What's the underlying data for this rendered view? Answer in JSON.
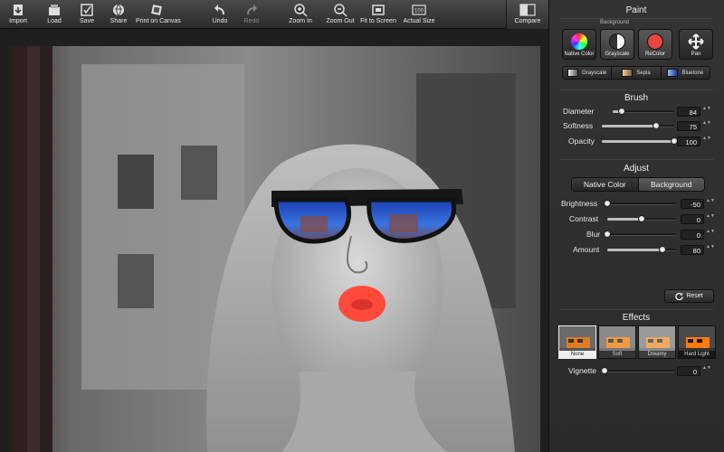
{
  "toolbar": {
    "items": [
      {
        "label": "Import",
        "icon": "import-icon"
      },
      {
        "label": "Load",
        "icon": "load-icon"
      },
      {
        "label": "Save",
        "icon": "save-icon"
      },
      {
        "label": "Share",
        "icon": "share-icon"
      },
      {
        "label": "Print on Canvas",
        "icon": "print-canvas-icon"
      },
      {
        "label": "Undo",
        "icon": "undo-icon"
      },
      {
        "label": "Redo",
        "icon": "redo-icon"
      },
      {
        "label": "Zoom In",
        "icon": "zoom-in-icon"
      },
      {
        "label": "Zoom Out",
        "icon": "zoom-out-icon"
      },
      {
        "label": "Fit to Screen",
        "icon": "fit-screen-icon"
      },
      {
        "label": "Actual Size",
        "icon": "actual-size-icon"
      }
    ],
    "compare": "Compare"
  },
  "panel": {
    "paint": {
      "title": "Paint",
      "background_label": "Background",
      "buttons": [
        {
          "label": "Native Color",
          "icon": "color-wheel-icon"
        },
        {
          "label": "Grayscale",
          "icon": "grayscale-icon"
        },
        {
          "label": "ReColor",
          "icon": "recolor-icon"
        },
        {
          "label": "Pan",
          "icon": "pan-icon"
        }
      ],
      "modes": [
        "Grayscale",
        "Sepia",
        "Bluetone"
      ]
    },
    "brush": {
      "title": "Brush",
      "diameter": {
        "label": "Diameter",
        "value": "84",
        "level": 0.14
      },
      "softness": {
        "label": "Softness",
        "value": "75",
        "level": 0.75
      },
      "opacity": {
        "label": "Opacity",
        "value": "100",
        "level": 1.0
      }
    },
    "adjust": {
      "title": "Adjust",
      "tabs": [
        "Native Color",
        "Background"
      ],
      "brightness": {
        "label": "Brightness",
        "value": "-50",
        "level": 0.0
      },
      "contrast": {
        "label": "Contrast",
        "value": "0",
        "level": 0.5
      },
      "blur": {
        "label": "Blur",
        "value": "0",
        "level": 0.0
      },
      "amount": {
        "label": "Amount",
        "value": "80",
        "level": 0.8
      },
      "reset": "Reset"
    },
    "effects": {
      "title": "Effects",
      "items": [
        "None",
        "Soft",
        "Dreamy",
        "Hard Light"
      ],
      "vignette": {
        "label": "Vignette",
        "value": "0",
        "level": 0.0
      }
    }
  },
  "colors": {
    "accent_red": "#e8453c",
    "panel_bg": "#2f2f2f"
  }
}
